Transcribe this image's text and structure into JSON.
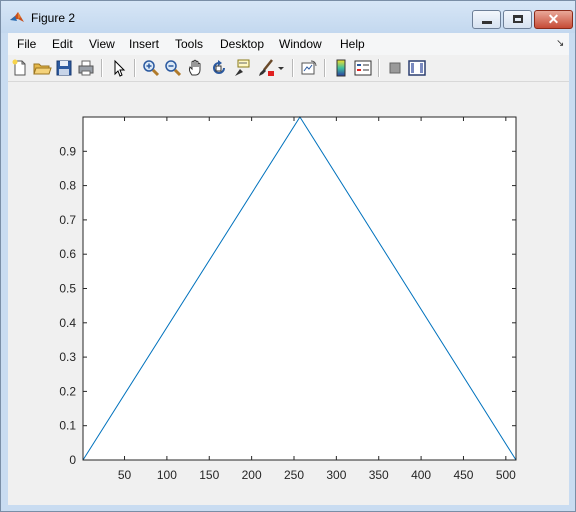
{
  "window": {
    "title": "Figure 2",
    "minimize_label": "",
    "maximize_label": "",
    "close_label": "✕"
  },
  "menu": {
    "items": [
      "File",
      "Edit",
      "View",
      "Insert",
      "Tools",
      "Desktop",
      "Window",
      "Help"
    ]
  },
  "toolbar": {
    "buttons": [
      "new-figure",
      "open-file",
      "save-figure",
      "print-figure",
      "edit-plot",
      "zoom-in",
      "zoom-out",
      "pan",
      "rotate-3d",
      "data-cursor",
      "brush",
      "brush-menu",
      "link-plot",
      "insert-colorbar",
      "insert-legend",
      "hide-plot-tools",
      "show-plot-tools"
    ]
  },
  "chart_data": {
    "type": "line",
    "title": "",
    "xlabel": "",
    "ylabel": "",
    "xlim": [
      1,
      512
    ],
    "ylim": [
      0,
      1
    ],
    "xticks": [
      50,
      100,
      150,
      200,
      250,
      300,
      350,
      400,
      450,
      500
    ],
    "yticks": [
      0,
      0.1,
      0.2,
      0.3,
      0.4,
      0.5,
      0.6,
      0.7,
      0.8,
      0.9
    ],
    "grid": false,
    "series": [
      {
        "color": "#0072bd",
        "x": [
          1,
          257,
          512
        ],
        "y": [
          0,
          1,
          0
        ]
      }
    ]
  }
}
